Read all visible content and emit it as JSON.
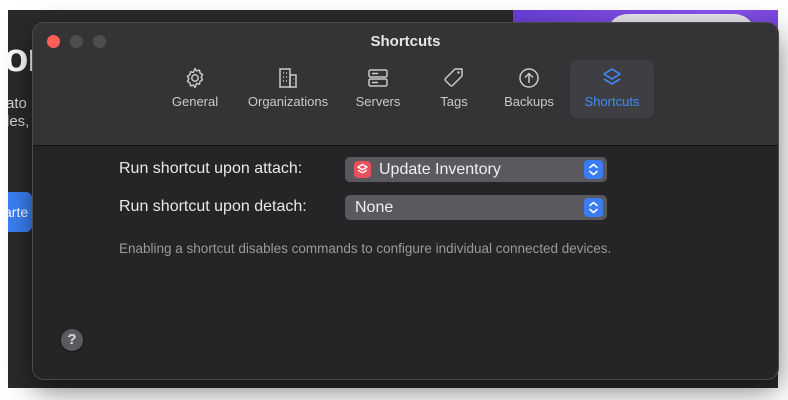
{
  "background_app": {
    "big_text": "or",
    "lines": [
      "ato",
      "les,"
    ],
    "button_text": "arte"
  },
  "window": {
    "title": "Shortcuts",
    "tabs": [
      {
        "label": "General",
        "icon": "gear-icon",
        "active": false
      },
      {
        "label": "Organizations",
        "icon": "building-icon",
        "active": false
      },
      {
        "label": "Servers",
        "icon": "server-icon",
        "active": false
      },
      {
        "label": "Tags",
        "icon": "tag-icon",
        "active": false
      },
      {
        "label": "Backups",
        "icon": "arrow-up-circle-icon",
        "active": false
      },
      {
        "label": "Shortcuts",
        "icon": "layers-icon",
        "active": true
      }
    ],
    "attach": {
      "label": "Run shortcut upon attach:",
      "value": "Update Inventory",
      "icon": "shortcuts-app-icon",
      "icon_color": "#e8505b"
    },
    "detach": {
      "label": "Run shortcut upon detach:",
      "value": "None"
    },
    "note": "Enabling a shortcut disables commands to configure individual connected devices.",
    "help_label": "?",
    "accent_color": "#3b7cf5"
  }
}
